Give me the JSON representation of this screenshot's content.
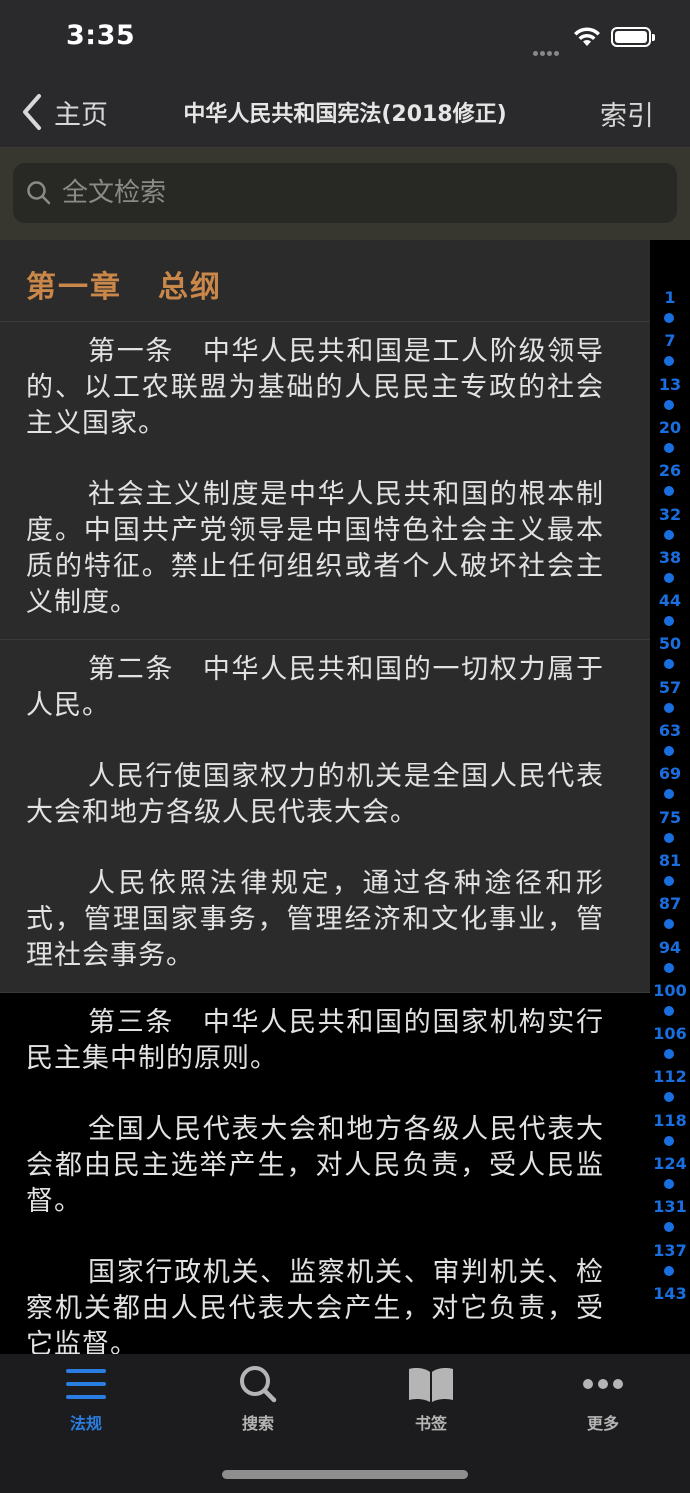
{
  "status": {
    "time": "3:35"
  },
  "nav": {
    "back_label": "主页",
    "title": "中华人民共和国宪法(2018修正)",
    "index_label": "索引"
  },
  "search": {
    "placeholder": "全文检索"
  },
  "chapter": {
    "number": "第一章",
    "title": "总纲"
  },
  "articles": [
    {
      "paragraphs": [
        "第一条　中华人民共和国是工人阶级领导的、以工农联盟为基础的人民民主专政的社会主义国家。",
        "社会主义制度是中华人民共和国的根本制度。中国共产党领导是中国特色社会主义最本质的特征。禁止任何组织或者个人破坏社会主义制度。"
      ]
    },
    {
      "paragraphs": [
        "第二条　中华人民共和国的一切权力属于人民。",
        "人民行使国家权力的机关是全国人民代表大会和地方各级人民代表大会。",
        "人民依照法律规定，通过各种途径和形式，管理国家事务，管理经济和文化事业，管理社会事务。"
      ]
    },
    {
      "paragraphs": [
        "第三条　中华人民共和国的国家机构实行民主集中制的原则。",
        "全国人民代表大会和地方各级人民代表大会都由民主选举产生，对人民负责，受人民监督。",
        "国家行政机关、监察机关、审判机关、检察机关都由人民代表大会产生，对它负责，受它监督。"
      ]
    }
  ],
  "index_numbers": [
    "1",
    "7",
    "13",
    "20",
    "26",
    "32",
    "38",
    "44",
    "50",
    "57",
    "63",
    "69",
    "75",
    "81",
    "87",
    "94",
    "100",
    "106",
    "112",
    "118",
    "124",
    "131",
    "137",
    "143"
  ],
  "tabs": [
    {
      "label": "法规",
      "icon": "list-icon",
      "active": true
    },
    {
      "label": "搜索",
      "icon": "search-icon",
      "active": false
    },
    {
      "label": "书签",
      "icon": "book-icon",
      "active": false
    },
    {
      "label": "更多",
      "icon": "more-icon",
      "active": false
    }
  ],
  "colors": {
    "accent": "#2a7de1",
    "chapter": "#c9874a",
    "index": "#1a6fe0"
  }
}
